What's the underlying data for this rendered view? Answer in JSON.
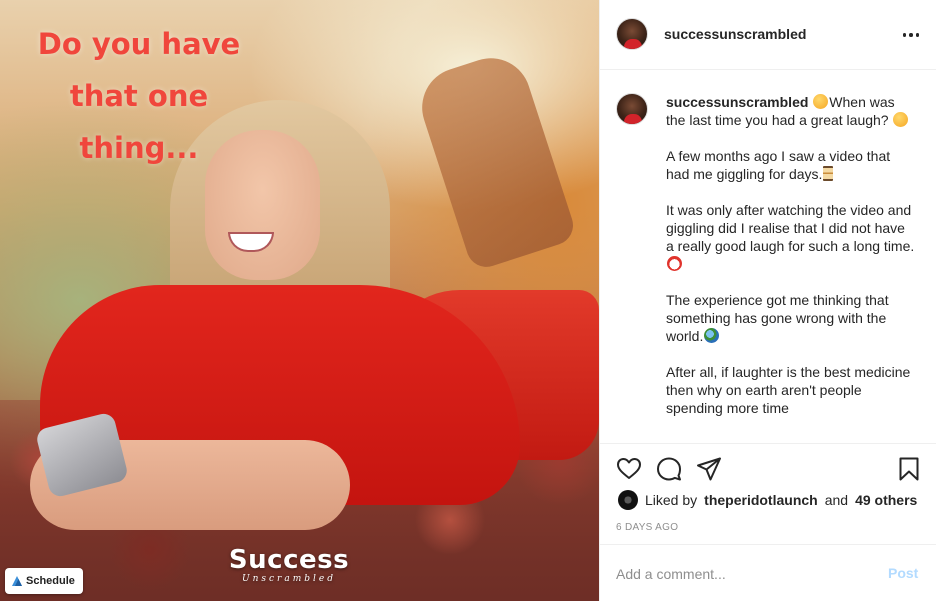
{
  "photo": {
    "overlay_text": [
      "Do you have",
      "that one",
      "thing..."
    ],
    "brand_main": "Success",
    "brand_sub": "Unscrambled",
    "schedule_label": "Schedule"
  },
  "header": {
    "username": "successunscrambled"
  },
  "caption": {
    "username": "successunscrambled",
    "paragraphs": [
      "When was the last time you had a great laugh?",
      "A few months ago I saw a video that had me giggling for days.",
      "It was only after watching the video and giggling did I realise that I did not have a really good laugh for such a long time.",
      "The experience got me thinking that something has gone wrong with the world.",
      "After all, if laughter is the best medicine then why on earth aren't people spending more time"
    ]
  },
  "likes": {
    "prefix": "Liked by",
    "user": "theperidotlaunch",
    "conjunction": "and",
    "others": "49 others"
  },
  "timestamp": "6 DAYS AGO",
  "comment": {
    "placeholder": "Add a comment...",
    "post_label": "Post",
    "post_color": "#b3dbff"
  },
  "icons": [
    "heart-icon",
    "comment-icon",
    "share-icon",
    "bookmark-icon",
    "more-icon",
    "calendar-icon"
  ],
  "colors": {
    "overlay_text": "#f0463c",
    "text": "#262626",
    "muted": "#8e8e8e",
    "border": "#efefef"
  }
}
